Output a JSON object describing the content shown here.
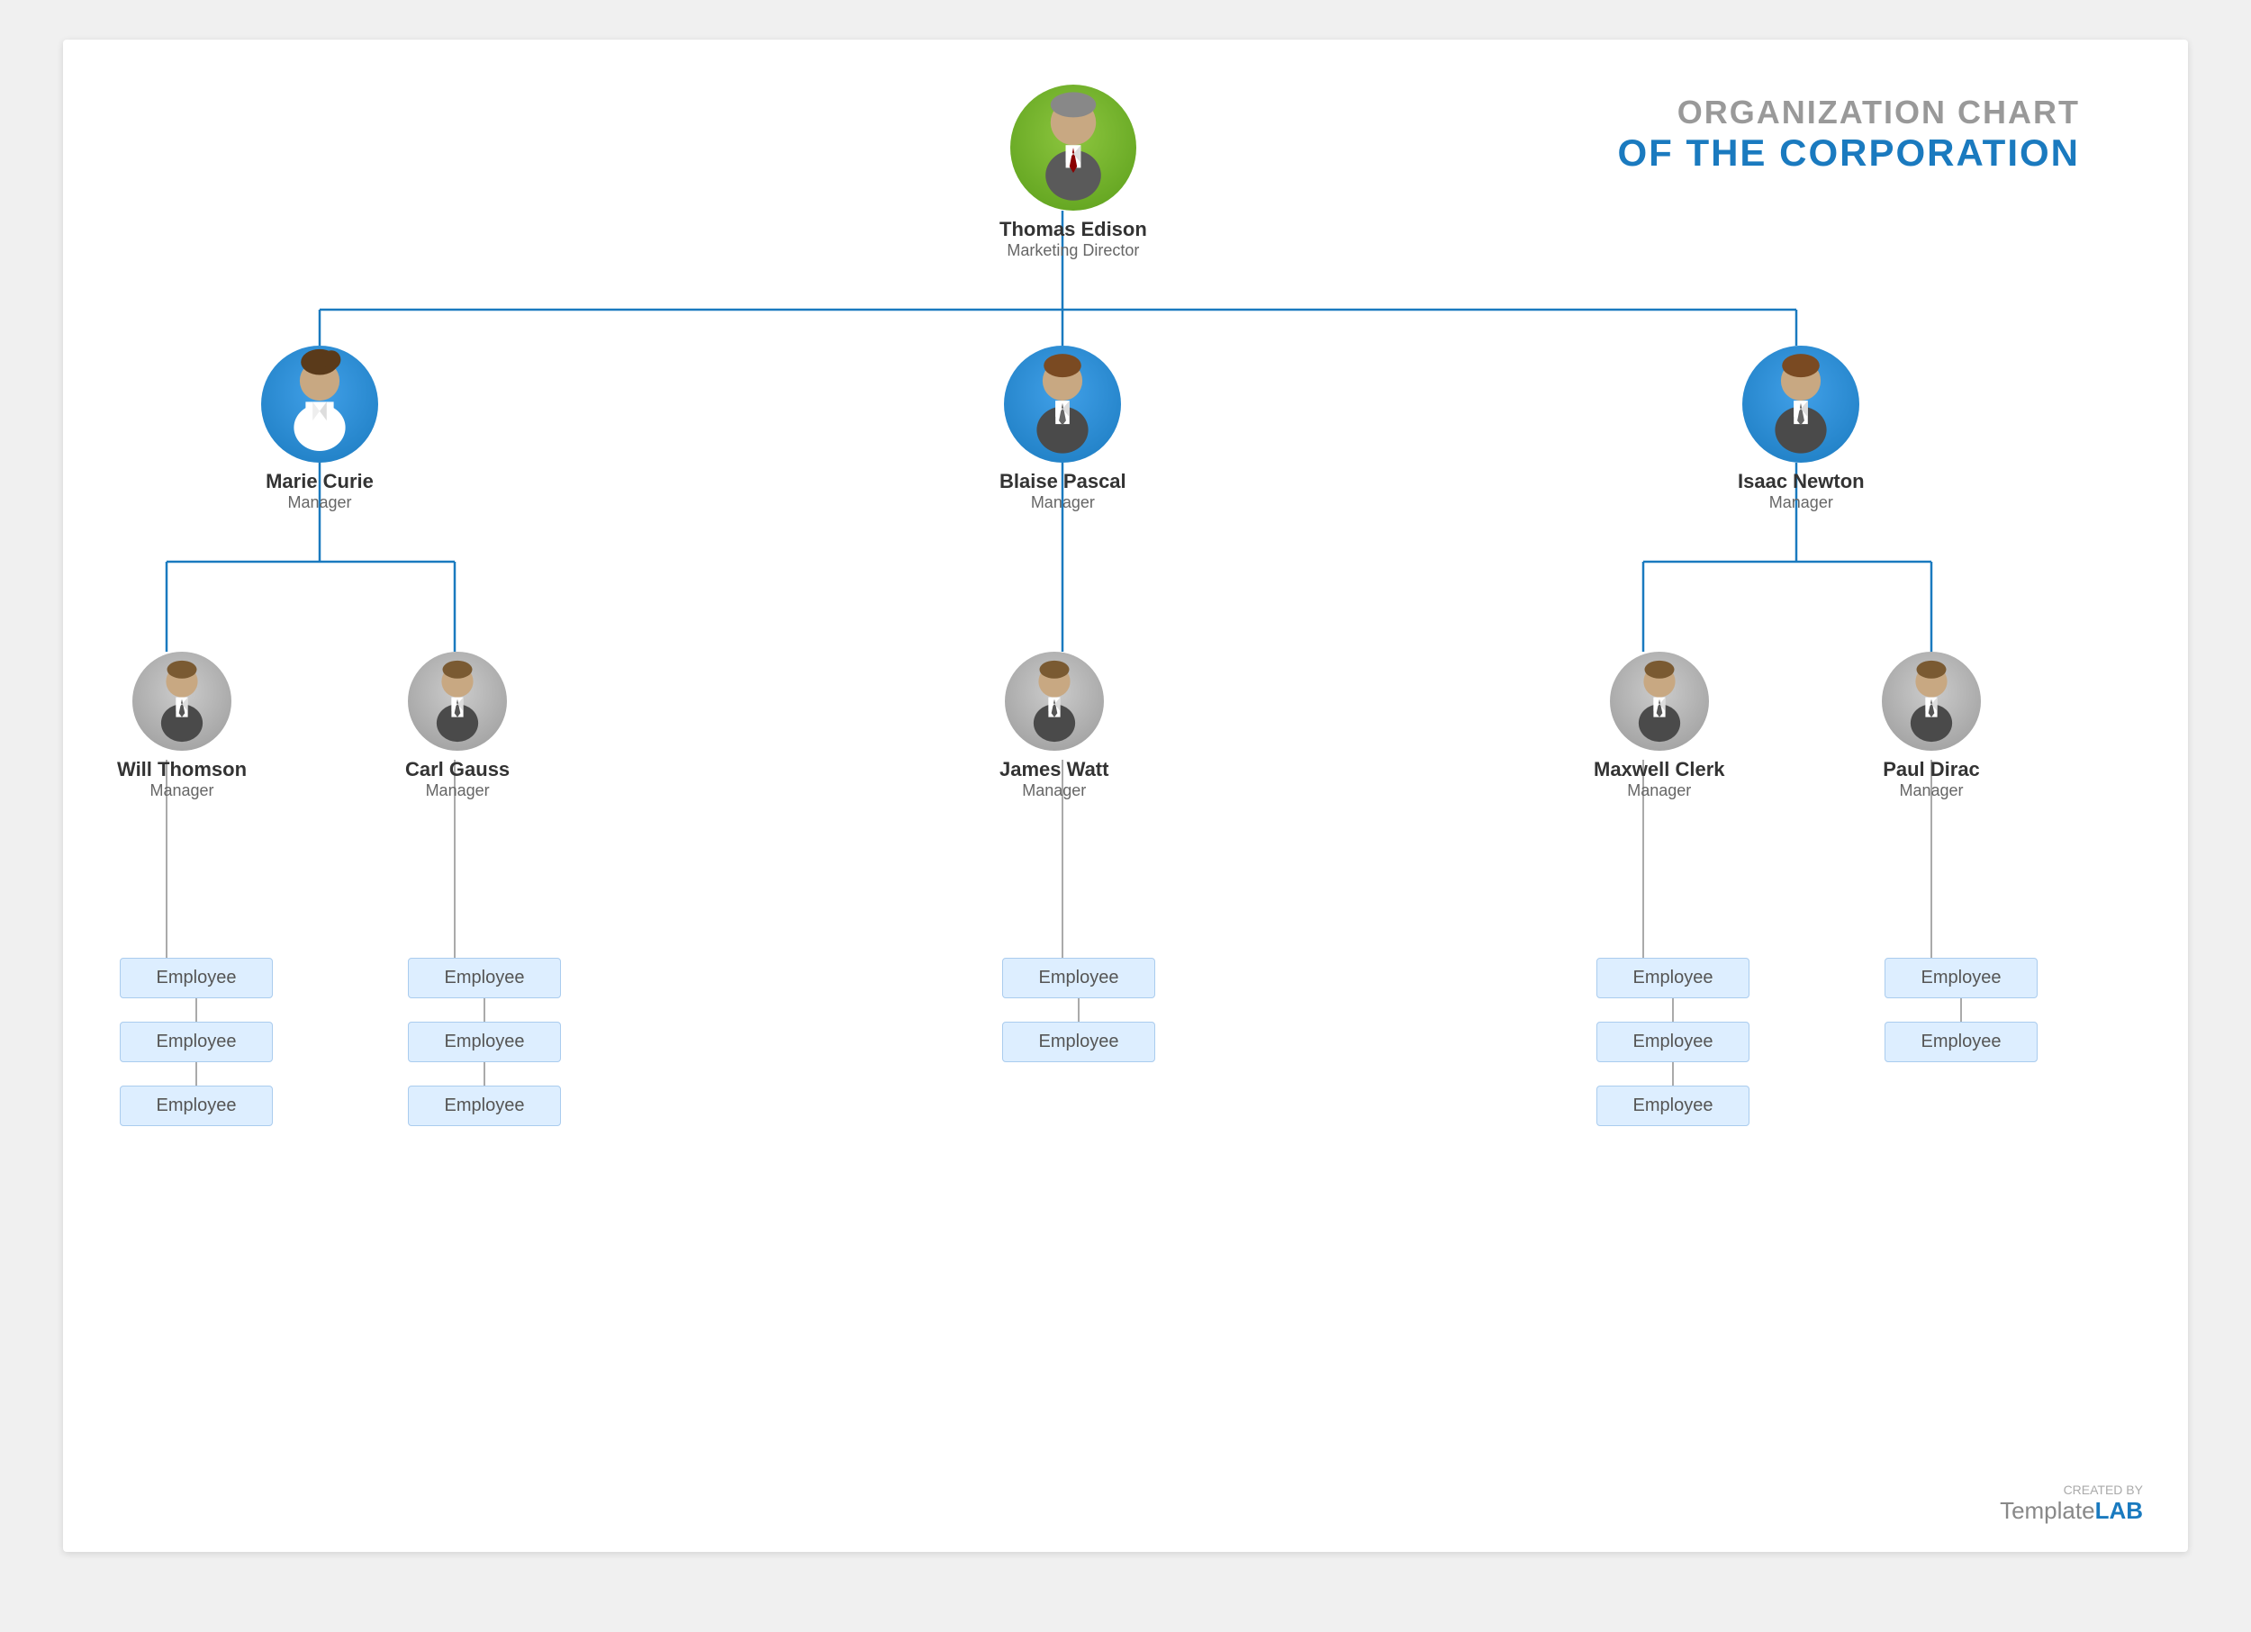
{
  "title": {
    "line1": "ORGANIZATION CHART",
    "line2": "OF THE CORPORATION"
  },
  "ceo": {
    "name": "Thomas Edison",
    "role": "Marketing Director"
  },
  "managers": [
    {
      "name": "Marie Curie",
      "role": "Manager",
      "gender": "female"
    },
    {
      "name": "Blaise Pascal",
      "role": "Manager",
      "gender": "male"
    },
    {
      "name": "Isaac Newton",
      "role": "Manager",
      "gender": "male"
    }
  ],
  "sub_managers": [
    {
      "name": "Will Thomson",
      "role": "Manager",
      "parent": 0
    },
    {
      "name": "Carl Gauss",
      "role": "Manager",
      "parent": 0
    },
    {
      "name": "James Watt",
      "role": "Manager",
      "parent": 1
    },
    {
      "name": "Maxwell Clerk",
      "role": "Manager",
      "parent": 2
    },
    {
      "name": "Paul Dirac",
      "role": "Manager",
      "parent": 2
    }
  ],
  "employees": {
    "will": [
      "Employee",
      "Employee",
      "Employee"
    ],
    "carl": [
      "Employee",
      "Employee",
      "Employee"
    ],
    "james": [
      "Employee",
      "Employee"
    ],
    "maxwell": [
      "Employee",
      "Employee",
      "Employee"
    ],
    "paul": [
      "Employee",
      "Employee"
    ]
  },
  "watermark": {
    "created_by": "CREATED BY",
    "template": "Template",
    "lab": "LAB"
  }
}
